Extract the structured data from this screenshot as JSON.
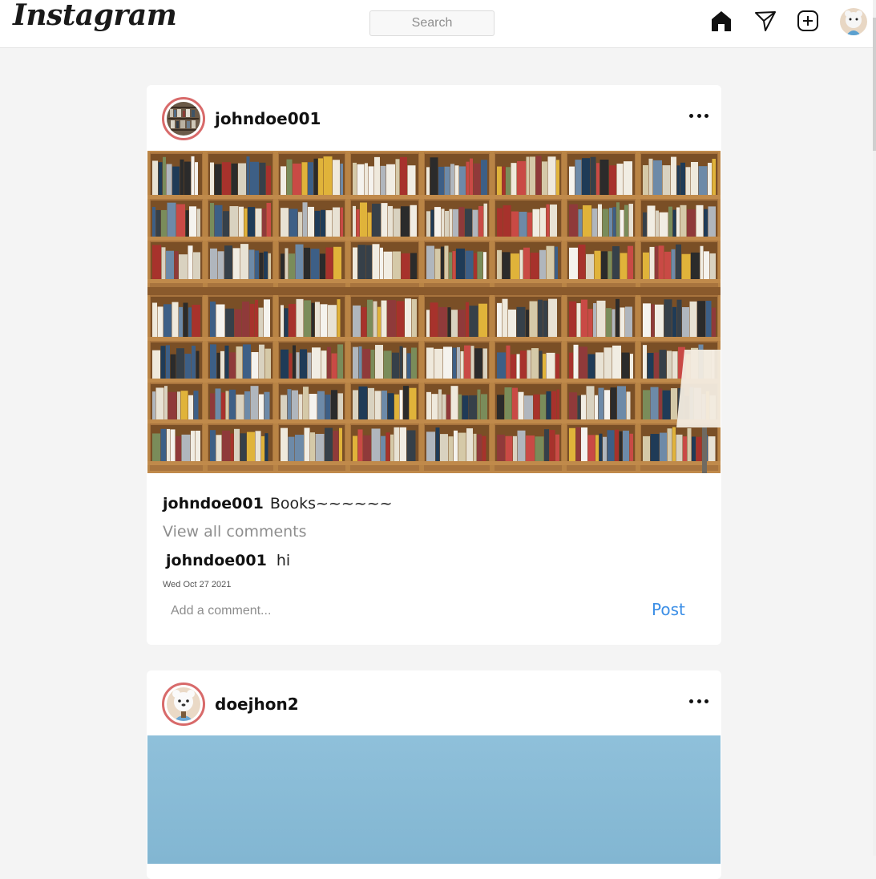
{
  "header": {
    "logo": "Instagram",
    "search_placeholder": "Search",
    "icons": [
      "home-icon",
      "direct-send-icon",
      "new-post-icon",
      "profile-avatar"
    ]
  },
  "feed": [
    {
      "username": "johndoe001",
      "caption_user": "johndoe001",
      "caption_text": "Books~~~~~~",
      "view_all": "View all comments",
      "comment_user": "johndoe001",
      "comment_text": "hi",
      "date": "Wed Oct 27 2021",
      "comment_placeholder": "Add a comment...",
      "post_label": "Post"
    },
    {
      "username": "doejhon2"
    }
  ],
  "colors": {
    "accent": "#3b8ee6",
    "avatar_ring": "#d86a6a",
    "background": "#f4f4f4"
  }
}
